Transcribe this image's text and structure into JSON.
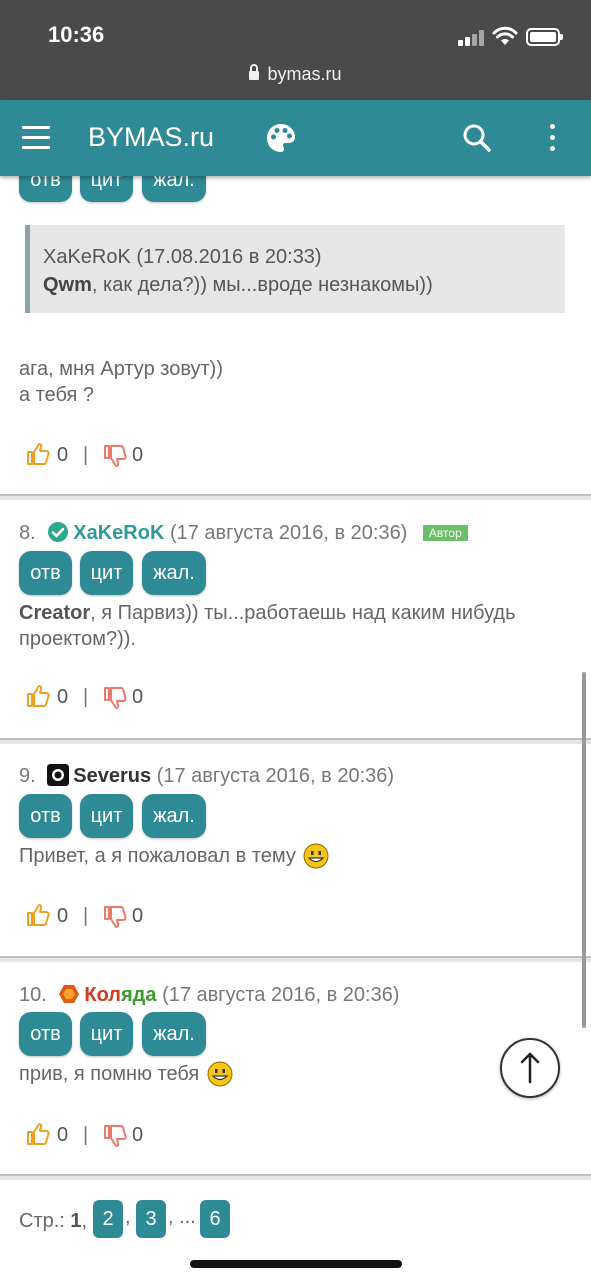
{
  "status_bar": {
    "time": "10:36",
    "url": "bymas.ru"
  },
  "app_bar": {
    "brand": "BYMAS.ru",
    "icons": [
      "menu-icon",
      "palette-icon",
      "search-icon",
      "more-vert-icon"
    ]
  },
  "actions": {
    "reply": "отв",
    "quote": "цит",
    "report": "жал."
  },
  "prev_post": {
    "quote_header": "XaKeRoK (17.08.2016 в 20:33)",
    "quote_user": "Qwm",
    "quote_text": ", как дела?)) мы...вроде незнакомы))",
    "line1": "ага, мня Артур зовут))",
    "line2": "а тебя ?",
    "likes": "0",
    "dislikes": "0"
  },
  "posts": [
    {
      "number": "8.",
      "username": "XaKeRoK",
      "date": "(17 августа 2016, в 20:36)",
      "badge": "Автор",
      "mention": "Creator",
      "text": ", я Парвиз)) ты...работаешь над каким нибудь проектом?)).",
      "likes": "0",
      "dislikes": "0"
    },
    {
      "number": "9.",
      "username": "Severus",
      "date": "(17 августа 2016, в 20:36)",
      "text": "Привет, а я пожаловал в тему",
      "likes": "0",
      "dislikes": "0"
    },
    {
      "number": "10.",
      "username": "Коляда",
      "date": "(17 августа 2016, в 20:36)",
      "text": "прив, я помню тебя",
      "likes": "0",
      "dislikes": "0"
    }
  ],
  "pagination": {
    "label": "Стр.:",
    "current": "1",
    "pages": [
      "2",
      "3",
      "6"
    ],
    "ellipsis": "..."
  },
  "colors": {
    "primary": "#2e8a94",
    "status_bar": "#4a4a4a",
    "username_8": "#2e9a9a",
    "username_9": "#333333",
    "username_10_a": "#d23a1e",
    "username_10_b": "#3a9a2a"
  }
}
